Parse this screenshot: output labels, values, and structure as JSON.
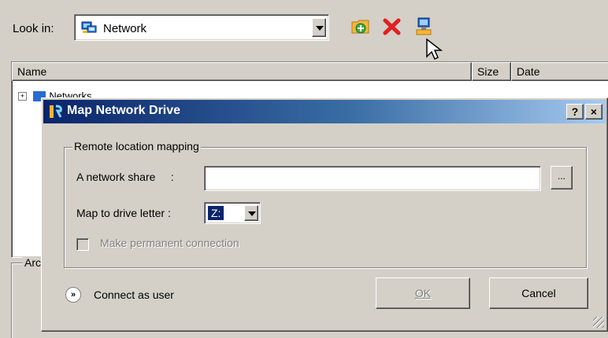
{
  "toolbar": {
    "look_in_label": "Look in:",
    "look_in_value": "Network",
    "icons": [
      "new-folder-icon",
      "delete-icon",
      "map-network-drive-icon"
    ]
  },
  "file_list": {
    "columns": [
      "Name",
      "Size",
      "Date"
    ],
    "tree": [
      {
        "label": "Networks"
      }
    ]
  },
  "archive_group_label": "Arc",
  "dialog": {
    "title": "Map Network Drive",
    "help_button": "?",
    "close_button": "×",
    "group_label": "Remote location mapping",
    "share_label": "A network share     :",
    "share_value": "",
    "browse_label": "...",
    "drive_label": "Map to drive letter :",
    "drive_value": "Z:",
    "permanent_label": "Make permanent connection",
    "permanent_checked": false,
    "connect_as_user_label": "Connect as user",
    "ok_label": "OK",
    "cancel_label": "Cancel"
  },
  "colors": {
    "titlebar_start": "#0a246a",
    "titlebar_end": "#a6caf0",
    "window_bg": "#d4d0c8",
    "disabled_text": "#808080"
  }
}
